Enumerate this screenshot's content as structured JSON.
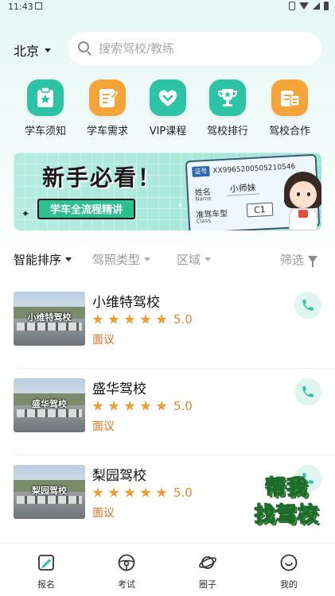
{
  "status_bar": {
    "time": "11:43"
  },
  "header": {
    "city": "北京",
    "search_placeholder": "搜索驾校/教练"
  },
  "quick_nav": [
    {
      "label": "学车须知",
      "icon": "clipboard-star-icon",
      "color": "#2cc3a7"
    },
    {
      "label": "学车需求",
      "icon": "notepad-pen-icon",
      "color": "#f5a43a"
    },
    {
      "label": "VIP课程",
      "icon": "vip-heart-icon",
      "color": "#2cc3a7"
    },
    {
      "label": "驾校排行",
      "icon": "trophy-icon",
      "color": "#2cc3a7"
    },
    {
      "label": "驾校合作",
      "icon": "cooperation-card-icon",
      "color": "#f5a43a"
    }
  ],
  "banner": {
    "title": "新手必看！",
    "subtitle": "学车全流程精讲",
    "card": {
      "tag": "证号",
      "number": "XX9965200505210546",
      "name_label": "姓名",
      "name_label_en": "Name",
      "name_value": "小师妹",
      "class_label": "准驾车型",
      "class_label_en": "Class",
      "class_value": "C1"
    }
  },
  "filters": {
    "sort": "智能排序",
    "license_type": "驾照类型",
    "region": "区域",
    "filter": "筛选"
  },
  "schools": [
    {
      "name": "小维特驾校",
      "thumb_label": "小维特驾校",
      "rating": "5.0",
      "stars": 5,
      "price": "面议"
    },
    {
      "name": "盛华驾校",
      "thumb_label": "盛华驾校",
      "rating": "5.0",
      "stars": 5,
      "price": "面议"
    },
    {
      "name": "梨园驾校",
      "thumb_label": "梨园驾校",
      "rating": "5.0",
      "stars": 5,
      "price": "面议"
    }
  ],
  "promo": {
    "line1": "帮我",
    "line2": "找驾校"
  },
  "tabs": [
    {
      "label": "报名",
      "icon": "signup-icon"
    },
    {
      "label": "考试",
      "icon": "steering-wheel-icon"
    },
    {
      "label": "圈子",
      "icon": "planet-icon"
    },
    {
      "label": "我的",
      "icon": "smiley-icon"
    }
  ],
  "colors": {
    "accent": "#2cc3a7",
    "orange": "#f5a43a",
    "price": "#e2751f",
    "star": "#f39a2e"
  }
}
